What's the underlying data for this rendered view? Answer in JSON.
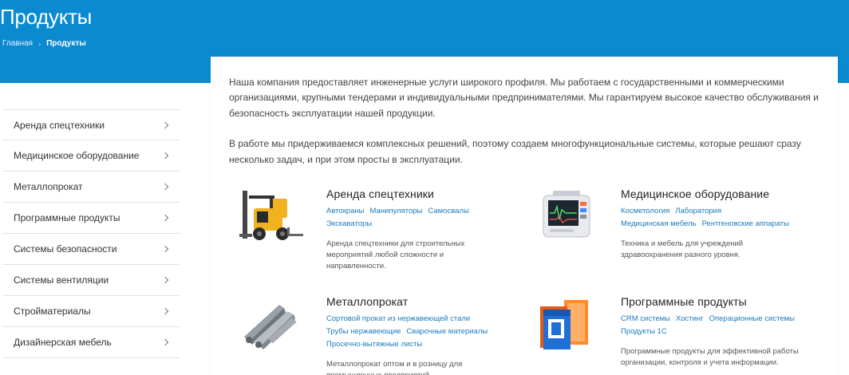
{
  "header": {
    "title": "Продукты",
    "breadcrumb": {
      "home": "Главная",
      "separator": "›",
      "current": "Продукты"
    }
  },
  "sidebar": {
    "items": [
      {
        "label": "Аренда спецтехники"
      },
      {
        "label": "Медицинское оборудование"
      },
      {
        "label": "Металлопрокат"
      },
      {
        "label": "Программные продукты"
      },
      {
        "label": "Системы безопасности"
      },
      {
        "label": "Системы вентиляции"
      },
      {
        "label": "Стройматериалы"
      },
      {
        "label": "Дизайнерская мебель"
      }
    ]
  },
  "intro": {
    "p1": "Наша компания предоставляет инженерные услуги широкого профиля. Мы работаем с государственными и коммерческими организациями, крупными тендерами и индивидуальными предпринимателями. Мы гарантируем высокое качество обслуживания и безопасность эксплуатации нашей продукции.",
    "p2": "В работе мы придерживаемся комплексных решений, поэтому создаем многофункциональные системы, которые решают сразу несколько задач, и при этом просты в эксплуатации."
  },
  "products": [
    {
      "title": "Аренда спецтехники",
      "tags": [
        "Автокраны",
        "Манипуляторы",
        "Самосвалы",
        "Экскаваторы"
      ],
      "description": "Аренда спецтехники для строительных мероприятий любой сложности и направленности."
    },
    {
      "title": "Медицинское оборудование",
      "tags": [
        "Косметология",
        "Лаборатория",
        "Медицинская мебель",
        "Рентгеновские аппараты"
      ],
      "description": "Техника и мебель для учреждений здравоохранения разного уровня."
    },
    {
      "title": "Металлопрокат",
      "tags": [
        "Сортовой прокат из нержавеющей стали",
        "Трубы нержавеющие",
        "Сварочные материалы",
        "Просечно-вытяжные листы"
      ],
      "description": "Металлопрокат оптом и в розницу для промышленных предприятий."
    },
    {
      "title": "Программные продукты",
      "tags": [
        "CRM системы",
        "Хостинг",
        "Операционные системы",
        "Продукты 1С"
      ],
      "description": "Программные продукты для эффективной работы организации, контроля и учета информации."
    }
  ],
  "colors": {
    "accent": "#0a8ad1",
    "link": "#1a7bbf"
  }
}
